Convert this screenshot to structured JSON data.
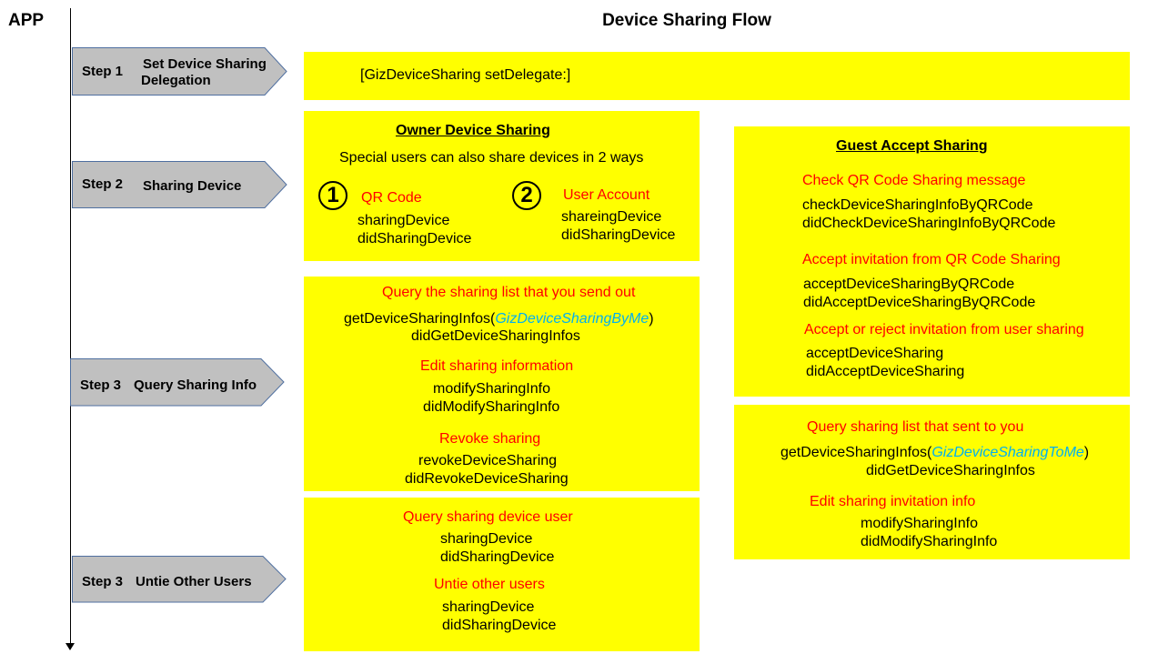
{
  "header": {
    "lane_label": "APP",
    "title": "Device Sharing Flow"
  },
  "colors": {
    "box_fill": "#ffff00",
    "step_fill": "#c0c0c0",
    "step_border": "#4f6fa0",
    "section_label": "#ff0000",
    "enum_text": "#00b0f0"
  },
  "steps": [
    {
      "number": "Step 1",
      "name_line1": "Set  Device Sharing",
      "name_line2": "Delegation"
    },
    {
      "number": "Step 2",
      "name": "Sharing Device"
    },
    {
      "number": "Step 3",
      "name": "Query Sharing Info"
    },
    {
      "number": "Step 3",
      "name": "Untie Other Users"
    }
  ],
  "step1_box": {
    "code": "[GizDeviceSharing setDelegate:]"
  },
  "owner_sharing": {
    "heading": "Owner Device Sharing",
    "subtitle": "Special users can also share devices in 2 ways",
    "ways": [
      {
        "badge": "1",
        "label": "QR Code",
        "methods": [
          "sharingDevice",
          "didSharingDevice"
        ]
      },
      {
        "badge": "2",
        "label": "User Account",
        "methods": [
          "shareingDevice",
          "didSharingDevice"
        ]
      }
    ]
  },
  "query_info": {
    "sections": [
      {
        "label": "Query the sharing list that you send out",
        "call_prefix": "getDeviceSharingInfos(",
        "call_arg": "GizDeviceSharingByMe",
        "call_suffix": ")",
        "callback": "didGetDeviceSharingInfos"
      },
      {
        "label": "Edit sharing information",
        "methods": [
          "modifySharingInfo",
          "didModifySharingInfo"
        ]
      },
      {
        "label": "Revoke sharing",
        "methods": [
          "revokeDeviceSharing",
          "didRevokeDeviceSharing"
        ]
      }
    ]
  },
  "untie_users": {
    "sections": [
      {
        "label": "Query sharing device user",
        "methods": [
          "sharingDevice",
          "didSharingDevice"
        ]
      },
      {
        "label": "Untie other users",
        "methods": [
          "sharingDevice",
          "didSharingDevice"
        ]
      }
    ]
  },
  "guest_accept": {
    "heading": "Guest Accept Sharing",
    "sections": [
      {
        "label": "Check QR Code Sharing message",
        "methods": [
          "checkDeviceSharingInfoByQRCode",
          "didCheckDeviceSharingInfoByQRCode"
        ]
      },
      {
        "label": "Accept invitation from QR Code Sharing",
        "methods": [
          "acceptDeviceSharingByQRCode",
          "didAcceptDeviceSharingByQRCode"
        ]
      },
      {
        "label": "Accept or reject invitation from user sharing",
        "methods": [
          "acceptDeviceSharing",
          "didAcceptDeviceSharing"
        ]
      }
    ]
  },
  "guest_query": {
    "sections": [
      {
        "label": "Query sharing list that sent to you",
        "call_prefix": "getDeviceSharingInfos(",
        "call_arg": "GizDeviceSharingToMe",
        "call_suffix": ")",
        "callback": "didGetDeviceSharingInfos"
      },
      {
        "label": "Edit sharing invitation info",
        "methods": [
          "modifySharingInfo",
          "didModifySharingInfo"
        ]
      }
    ]
  }
}
